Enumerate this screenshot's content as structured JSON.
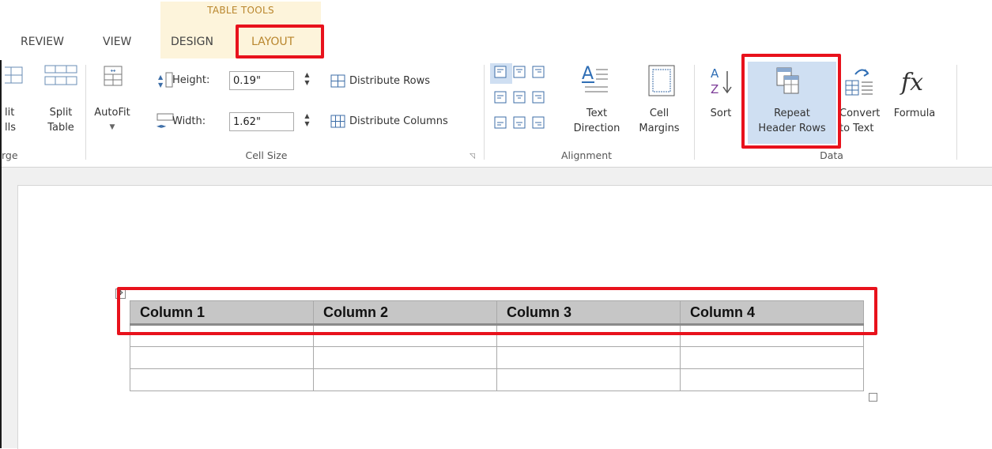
{
  "tabs": {
    "table_tools": "TABLE TOOLS",
    "review": "REVIEW",
    "view": "VIEW",
    "design": "DESIGN",
    "layout": "LAYOUT"
  },
  "merge": {
    "split_cells_line1": "lit",
    "split_cells_line2": "lls",
    "split_table_line1": "Split",
    "split_table_line2": "Table",
    "group_label": "rge"
  },
  "cell_size": {
    "autofit": "AutoFit",
    "height_label": "Height:",
    "height_value": "0.19\"",
    "width_label": "Width:",
    "width_value": "1.62\"",
    "distribute_rows": "Distribute Rows",
    "distribute_columns": "Distribute Columns",
    "group_label": "Cell Size"
  },
  "alignment": {
    "text_direction_line1": "Text",
    "text_direction_line2": "Direction",
    "cell_margins_line1": "Cell",
    "cell_margins_line2": "Margins",
    "group_label": "Alignment"
  },
  "data_group": {
    "sort": "Sort",
    "repeat_header_line1": "Repeat",
    "repeat_header_line2": "Header Rows",
    "convert_line1": "Convert",
    "convert_line2": "to Text",
    "formula": "Formula",
    "group_label": "Data"
  },
  "table": {
    "headers": [
      "Column 1",
      "Column 2",
      "Column 3",
      "Column 4"
    ]
  },
  "colors": {
    "highlight": "#e8121c",
    "accent": "#b9862d"
  }
}
